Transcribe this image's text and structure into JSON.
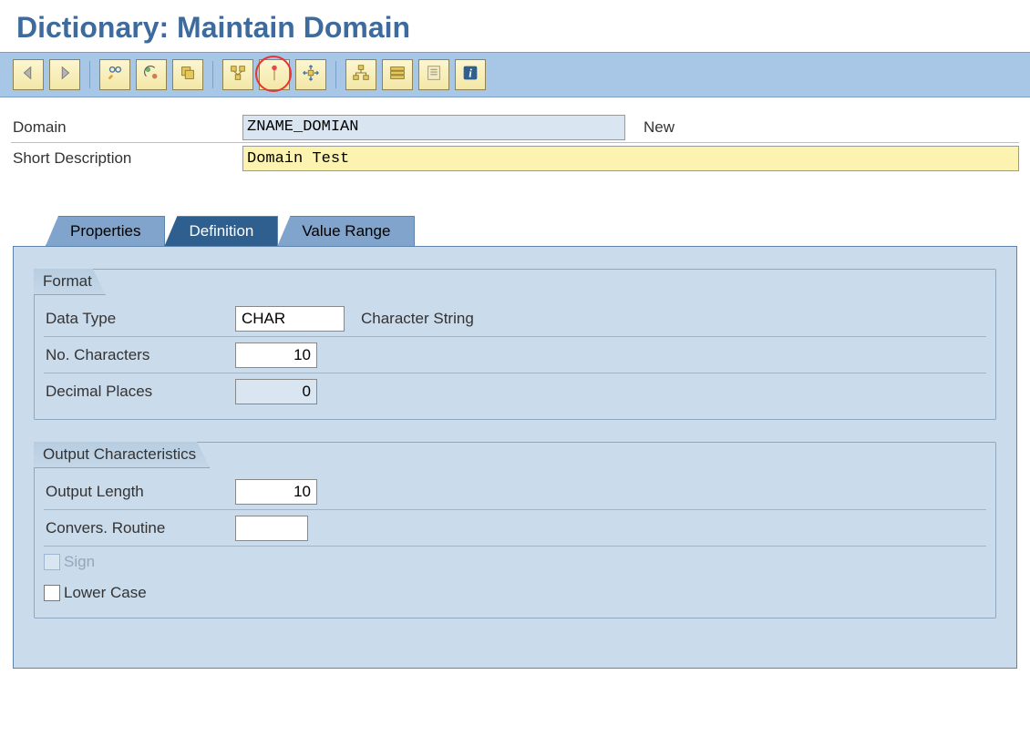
{
  "page_title": "Dictionary: Maintain Domain",
  "header": {
    "domain_label": "Domain",
    "domain_value": "ZNAME_DOMIAN",
    "status": "New",
    "desc_label": "Short Description",
    "desc_value": "Domain Test"
  },
  "tabs": {
    "properties": "Properties",
    "definition": "Definition",
    "value_range": "Value Range"
  },
  "format": {
    "title": "Format",
    "data_type_label": "Data Type",
    "data_type_value": "CHAR",
    "data_type_note": "Character String",
    "no_chars_label": "No. Characters",
    "no_chars_value": "10",
    "decimal_label": "Decimal Places",
    "decimal_value": "0"
  },
  "output": {
    "title": "Output Characteristics",
    "out_len_label": "Output Length",
    "out_len_value": "10",
    "conv_label": "Convers. Routine",
    "conv_value": "",
    "sign_label": "Sign",
    "lower_label": "Lower Case"
  }
}
